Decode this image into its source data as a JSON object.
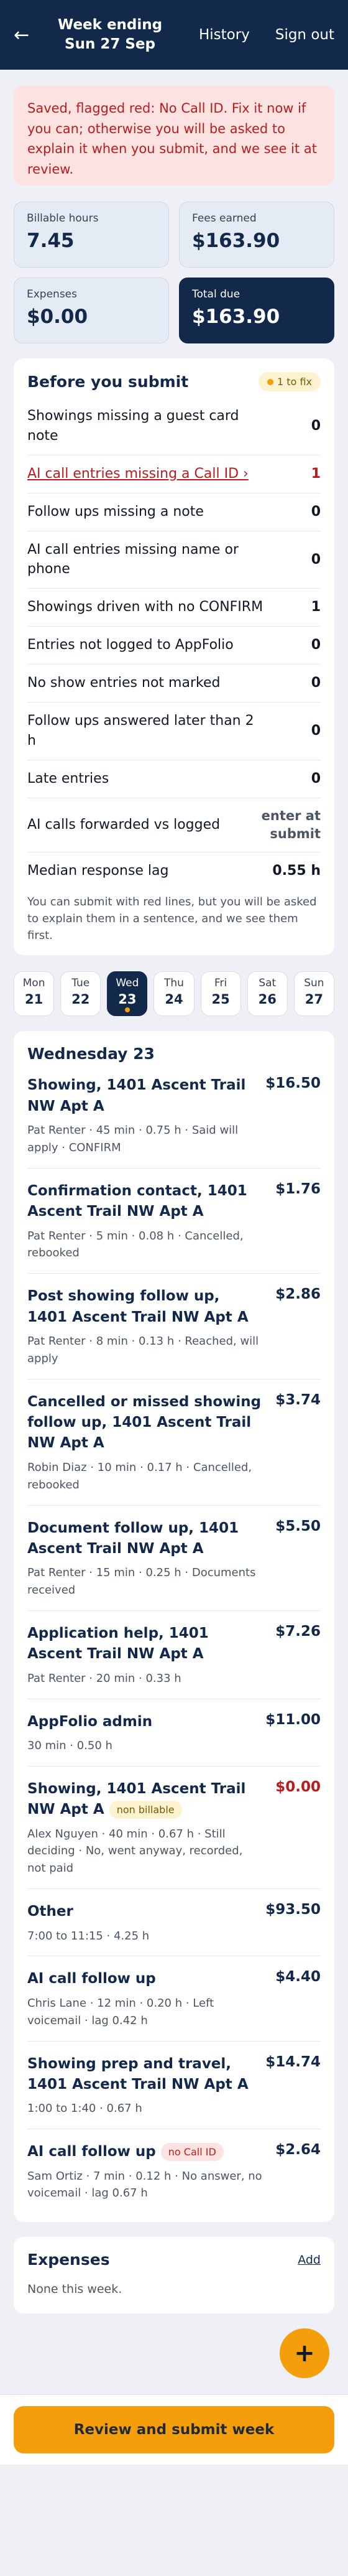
{
  "header": {
    "back_icon": "←",
    "title_line1": "Week ending",
    "title_line2": "Sun 27 Sep",
    "history": "History",
    "signout": "Sign out"
  },
  "alert": "Saved, flagged red: No Call ID. Fix it now if you can; otherwise you will be asked to explain it when you submit, and we see it at review.",
  "stats": {
    "billable_label": "Billable hours",
    "billable_value": "7.45",
    "fees_label": "Fees earned",
    "fees_value": "$163.90",
    "expenses_label": "Expenses",
    "expenses_value": "$0.00",
    "total_label": "Total due",
    "total_value": "$163.90"
  },
  "checklist": {
    "title": "Before you submit",
    "badge": "1 to fix",
    "rows": [
      {
        "label": "Showings missing a guest card note",
        "value": "0"
      },
      {
        "label": "AI call entries missing a Call ID ›",
        "value": "1"
      },
      {
        "label": "Follow ups missing a note",
        "value": "0"
      },
      {
        "label": "AI call entries missing name or phone",
        "value": "0"
      },
      {
        "label": "Showings driven with no CONFIRM",
        "value": "1"
      },
      {
        "label": "Entries not logged to AppFolio",
        "value": "0"
      },
      {
        "label": "No show entries not marked",
        "value": "0"
      },
      {
        "label": "Follow ups answered later than 2 h",
        "value": "0"
      },
      {
        "label": "Late entries",
        "value": "0"
      },
      {
        "label": "AI calls forwarded vs logged",
        "value": "enter at submit"
      },
      {
        "label": "Median response lag",
        "value": "0.55 h"
      }
    ],
    "note": "You can submit with red lines, but you will be asked to explain them in a sentence, and we see them first."
  },
  "days": [
    {
      "name": "Mon",
      "date": "21"
    },
    {
      "name": "Tue",
      "date": "22"
    },
    {
      "name": "Wed",
      "date": "23"
    },
    {
      "name": "Thu",
      "date": "24"
    },
    {
      "name": "Fri",
      "date": "25"
    },
    {
      "name": "Sat",
      "date": "26"
    },
    {
      "name": "Sun",
      "date": "27"
    }
  ],
  "day_view": {
    "title": "Wednesday 23",
    "entries": [
      {
        "title": "Showing, 1401 Ascent Trail NW Apt A",
        "detail": "Pat Renter · 45 min · 0.75 h · Said will apply · CONFIRM",
        "amount": "$16.50"
      },
      {
        "title": "Confirmation contact, 1401 Ascent Trail NW Apt A",
        "detail": "Pat Renter · 5 min · 0.08 h · Cancelled, rebooked",
        "amount": "$1.76"
      },
      {
        "title": "Post showing follow up, 1401 Ascent Trail NW Apt A",
        "detail": "Pat Renter · 8 min · 0.13 h · Reached, will apply",
        "amount": "$2.86"
      },
      {
        "title": "Cancelled or missed showing follow up, 1401 Ascent Trail NW Apt A",
        "detail": "Robin Diaz · 10 min · 0.17 h · Cancelled, rebooked",
        "amount": "$3.74"
      },
      {
        "title": "Document follow up, 1401 Ascent Trail NW Apt A",
        "detail": "Pat Renter · 15 min · 0.25 h · Documents received",
        "amount": "$5.50"
      },
      {
        "title": "Application help, 1401 Ascent Trail NW Apt A",
        "detail": "Pat Renter · 20 min · 0.33 h",
        "amount": "$7.26"
      },
      {
        "title": "AppFolio admin",
        "detail": "30 min · 0.50 h",
        "amount": "$11.00"
      },
      {
        "title": "Showing, 1401 Ascent Trail NW Apt A",
        "tag": "non billable",
        "detail": "Alex Nguyen · 40 min · 0.67 h · Still deciding · No, went anyway, recorded, not paid",
        "amount": "$0.00"
      },
      {
        "title": "Other",
        "detail": "7:00 to 11:15 · 4.25 h",
        "amount": "$93.50"
      },
      {
        "title": "AI call follow up",
        "detail": "Chris Lane · 12 min · 0.20 h · Left voicemail · lag 0.42 h",
        "amount": "$4.40"
      },
      {
        "title": "Showing prep and travel, 1401 Ascent Trail NW Apt A",
        "detail": "1:00 to 1:40 · 0.67 h",
        "amount": "$14.74"
      },
      {
        "title": "AI call follow up",
        "tag": "no Call ID",
        "detail": "Sam Ortiz · 7 min · 0.12 h · No answer, no voicemail · lag 0.67 h",
        "amount": "$2.64"
      }
    ]
  },
  "expenses": {
    "title": "Expenses",
    "add": "Add",
    "none": "None this week."
  },
  "fab": "+",
  "submit": "Review and submit week",
  "colors": {
    "navy": "#13294b",
    "amber": "#f59e0b",
    "alert_bg": "#fde2e2",
    "alert_text": "#b91c1c"
  }
}
